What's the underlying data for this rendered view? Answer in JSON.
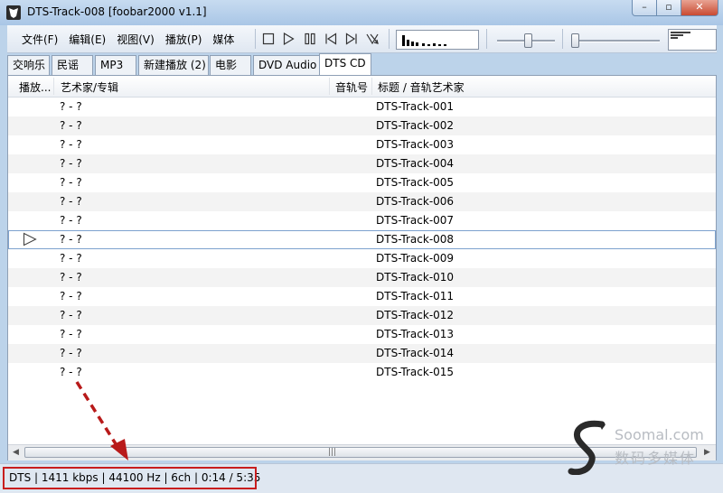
{
  "window": {
    "title": "DTS-Track-008  [foobar2000 v1.1]",
    "min_glyph": "–",
    "max_glyph": "▫",
    "close_glyph": "✕"
  },
  "menu": [
    {
      "label": "文件(F)"
    },
    {
      "label": "编辑(E)"
    },
    {
      "label": "视图(V)"
    },
    {
      "label": "播放(P)"
    },
    {
      "label": "媒体"
    }
  ],
  "toolbar": {
    "icons": [
      "stop-icon",
      "play-icon",
      "pause-icon",
      "previous-icon",
      "next-icon",
      "random-icon"
    ],
    "volume_level": 0.55,
    "seek_level": 0.0
  },
  "tabs": [
    {
      "label": "交响乐"
    },
    {
      "label": "民谣"
    },
    {
      "label": "MP3"
    },
    {
      "label": "新建播放 (2)"
    },
    {
      "label": "电影"
    },
    {
      "label": "DVD Audio"
    },
    {
      "label": "DTS CD",
      "active": true
    }
  ],
  "columns": {
    "playing": "播放...",
    "artist_album": "艺术家/专辑",
    "track_no": "音轨号",
    "title_artist": "标题 / 音轨艺术家"
  },
  "tracks": [
    {
      "artist": "? - ?",
      "title": "DTS-Track-001"
    },
    {
      "artist": "? - ?",
      "title": "DTS-Track-002"
    },
    {
      "artist": "? - ?",
      "title": "DTS-Track-003"
    },
    {
      "artist": "? - ?",
      "title": "DTS-Track-004"
    },
    {
      "artist": "? - ?",
      "title": "DTS-Track-005"
    },
    {
      "artist": "? - ?",
      "title": "DTS-Track-006"
    },
    {
      "artist": "? - ?",
      "title": "DTS-Track-007"
    },
    {
      "artist": "? - ?",
      "title": "DTS-Track-008",
      "playing": true
    },
    {
      "artist": "? - ?",
      "title": "DTS-Track-009"
    },
    {
      "artist": "? - ?",
      "title": "DTS-Track-010"
    },
    {
      "artist": "? - ?",
      "title": "DTS-Track-011"
    },
    {
      "artist": "? - ?",
      "title": "DTS-Track-012"
    },
    {
      "artist": "? - ?",
      "title": "DTS-Track-013"
    },
    {
      "artist": "? - ?",
      "title": "DTS-Track-014"
    },
    {
      "artist": "? - ?",
      "title": "DTS-Track-015"
    }
  ],
  "status": {
    "text": "DTS | 1411 kbps | 44100 Hz | 6ch | 0:14 / 5:35"
  },
  "watermark": {
    "brand": "Soomal.com",
    "sub": "数码多媒体"
  },
  "colors": {
    "annotation": "#c81e1e",
    "selection_border": "#7da2ce"
  }
}
